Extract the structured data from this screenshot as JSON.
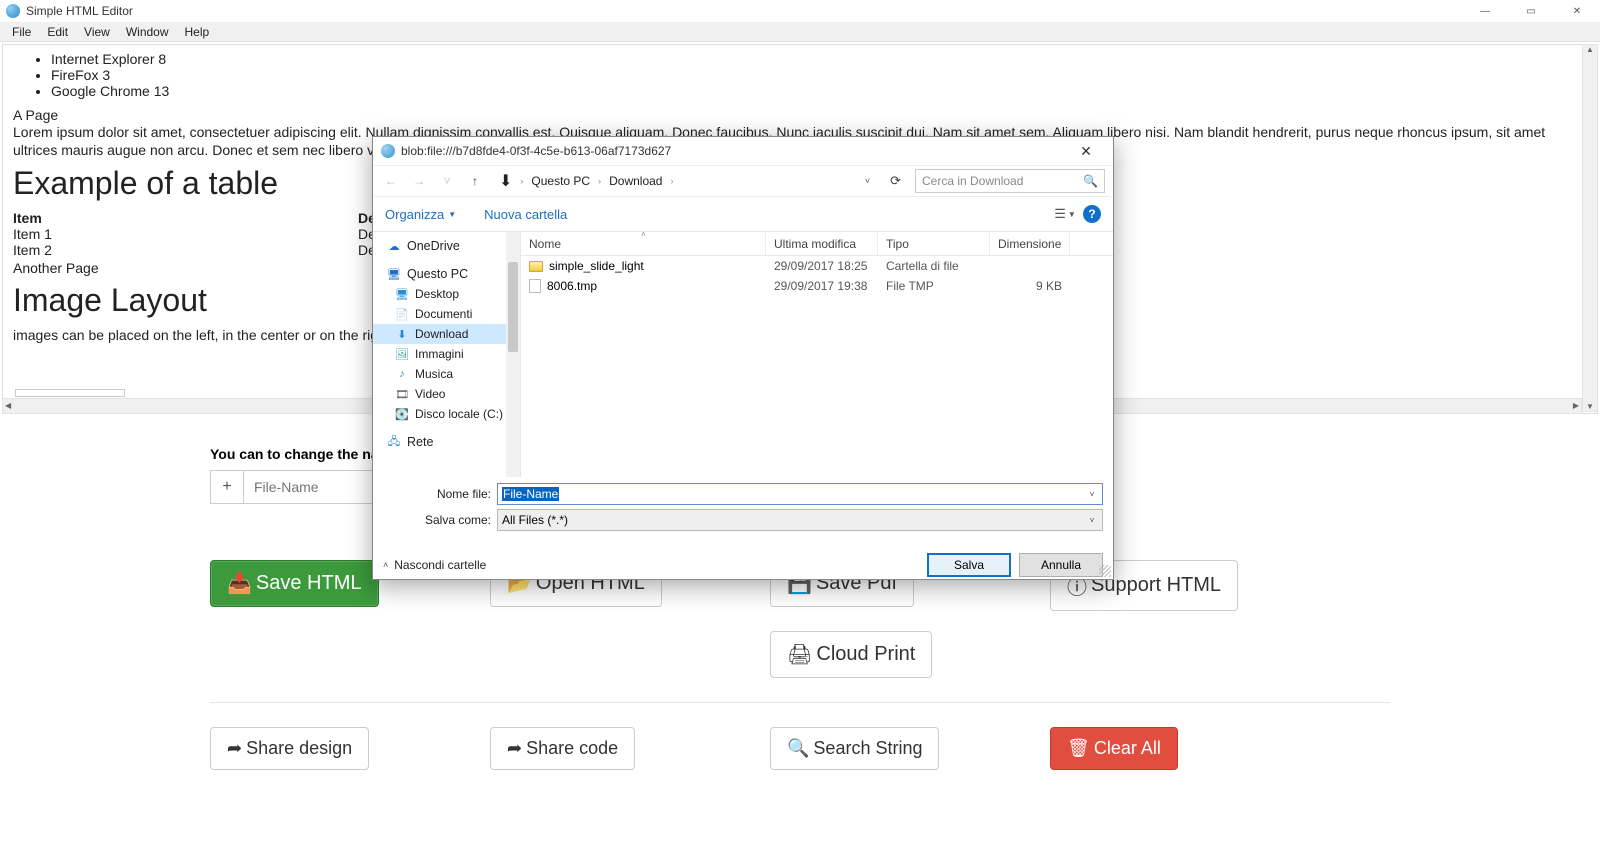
{
  "titlebar": {
    "title": "Simple HTML Editor"
  },
  "menubar": [
    "File",
    "Edit",
    "View",
    "Window",
    "Help"
  ],
  "editor": {
    "list": [
      "Internet Explorer 8",
      "FireFox 3",
      "Google Chrome 13"
    ],
    "page_label": "A Page",
    "lorem": "Lorem ipsum dolor sit amet, consectetuer adipiscing elit. Nullam dignissim convallis est. Quisque aliquam. Donec faucibus. Nunc iaculis suscipit dui. Nam sit amet sem. Aliquam libero nisi. Nam blandit hendrerit, purus neque rhoncus ipsum, sit amet ultrices mauris augue non arcu. Donec et sem nec libero vivel",
    "h_table": "Example of a table",
    "th_item": "Item",
    "th_desc": "De",
    "r1c1": "Item 1",
    "r1c2": "De",
    "r2c1": "Item 2",
    "r2c2": "De",
    "another": "Another Page",
    "h_img": "Image Layout",
    "img_txt": "images can be placed on the left, in the center or on the right"
  },
  "section": {
    "change_label": "You can to change the na",
    "plus": "+",
    "filename_ph": "File-Name",
    "buttons": {
      "save_html": "Save HTML",
      "open_html": "Open HTML",
      "save_pdf": "Save Pdf",
      "support_html": "Support HTML",
      "cloud_print": "Cloud Print",
      "share_design": "Share design",
      "share_code": "Share code",
      "search_string": "Search String",
      "clear_all": "Clear All"
    }
  },
  "dialog": {
    "title": "blob:file:///b7d8fde4-0f3f-4c5e-b613-06af7173d627",
    "bc1": "Questo PC",
    "bc2": "Download",
    "search_ph": "Cerca in Download",
    "organize": "Organizza",
    "new_folder": "Nuova cartella",
    "cols": {
      "name": "Nome",
      "date": "Ultima modifica",
      "type": "Tipo",
      "size": "Dimensione"
    },
    "tree": {
      "onedrive": "OneDrive",
      "thispc": "Questo PC",
      "desktop": "Desktop",
      "documents": "Documenti",
      "download": "Download",
      "images": "Immagini",
      "music": "Musica",
      "video": "Video",
      "disk": "Disco locale (C:)",
      "network": "Rete"
    },
    "files": [
      {
        "name": "simple_slide_light",
        "date": "29/09/2017 18:25",
        "type": "Cartella di file",
        "size": "",
        "kind": "folder"
      },
      {
        "name": "8006.tmp",
        "date": "29/09/2017 19:38",
        "type": "File TMP",
        "size": "9 KB",
        "kind": "file"
      }
    ],
    "filename_label": "Nome file:",
    "filename_value": "File-Name",
    "saveas_label": "Salva come:",
    "saveas_value": "All Files (*.*)",
    "hide_folders": "Nascondi cartelle",
    "save": "Salva",
    "cancel": "Annulla"
  }
}
